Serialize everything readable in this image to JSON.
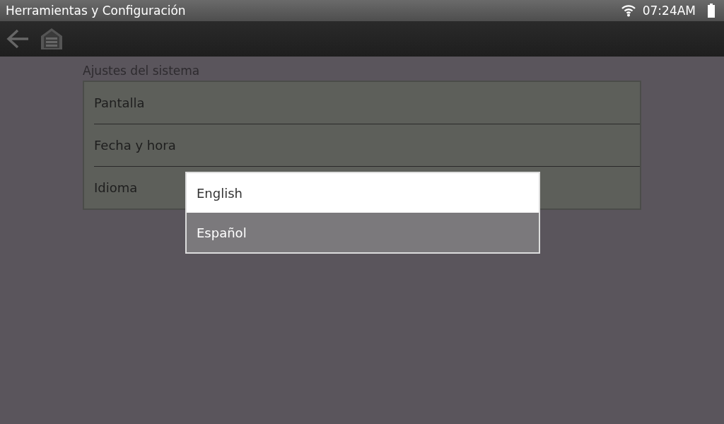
{
  "status_bar": {
    "title": "Herramientas y Configuración",
    "time": "07:24AM"
  },
  "section": {
    "title": "Ajustes del sistema",
    "items": [
      {
        "label": "Pantalla"
      },
      {
        "label": "Fecha y hora"
      },
      {
        "label": "Idioma"
      }
    ]
  },
  "language_menu": {
    "options": [
      {
        "label": "English",
        "selected": false
      },
      {
        "label": "Español",
        "selected": true
      }
    ]
  }
}
